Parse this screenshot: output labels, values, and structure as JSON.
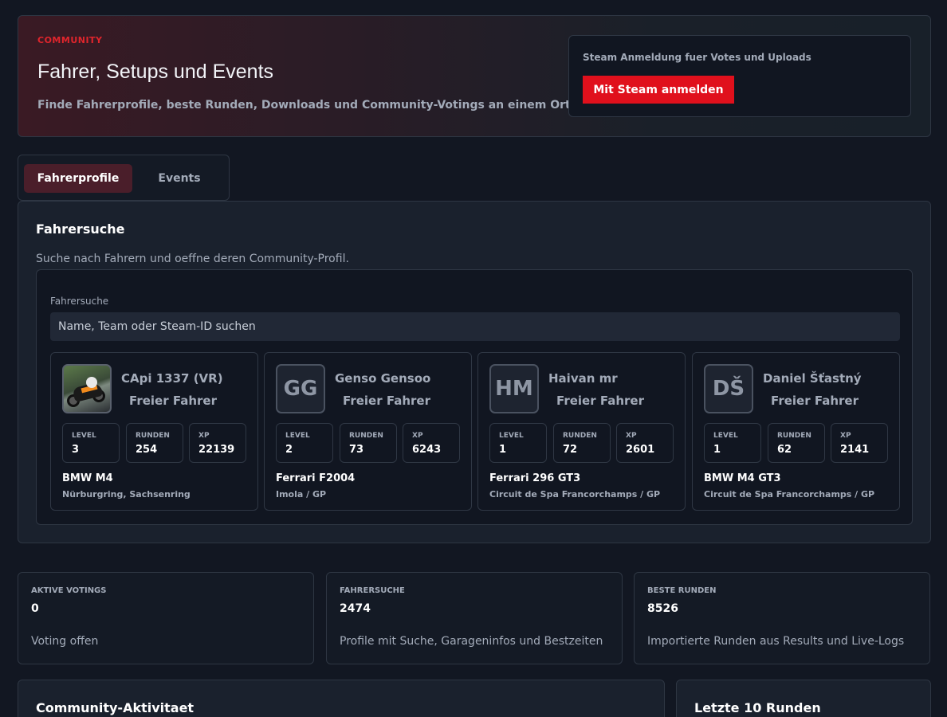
{
  "hero": {
    "eyebrow": "COMMUNITY",
    "title": "Fahrer, Setups und Events",
    "subtitle": "Finde Fahrerprofile, beste Runden, Downloads und Community-Votings an einem Ort.",
    "login_hint": "Steam Anmeldung fuer Votes und Uploads",
    "login_button": "Mit Steam anmelden",
    "accent_color": "#e0101c"
  },
  "tabs": [
    {
      "label": "Fahrerprofile",
      "active": true
    },
    {
      "label": "Events",
      "active": false
    }
  ],
  "driver_search": {
    "title": "Fahrersuche",
    "description": "Suche nach Fahrern und oeffne deren Community-Profil.",
    "field_label": "Fahrersuche",
    "placeholder": "Name, Team oder Steam-ID suchen",
    "stat_labels": {
      "level": "LEVEL",
      "runden": "RUNDEN",
      "xp": "XP"
    },
    "drivers": [
      {
        "name": "CApi 1337 (VR)",
        "role": "Freier Fahrer",
        "avatar": "motorcycle-photo",
        "initials": "",
        "level": "3",
        "runden": "254",
        "xp": "22139",
        "car": "BMW M4",
        "track": "Nürburgring, Sachsenring"
      },
      {
        "name": "Genso Gensoo",
        "role": "Freier Fahrer",
        "avatar": "initials",
        "initials": "GG",
        "level": "2",
        "runden": "73",
        "xp": "6243",
        "car": "Ferrari F2004",
        "track": "Imola / GP"
      },
      {
        "name": "Haivan mr",
        "role": "Freier Fahrer",
        "avatar": "initials",
        "initials": "HM",
        "level": "1",
        "runden": "72",
        "xp": "2601",
        "car": "Ferrari 296 GT3",
        "track": "Circuit de Spa Francorchamps / GP"
      },
      {
        "name": "Daniel Šťastný",
        "role": "Freier Fahrer",
        "avatar": "initials",
        "initials": "DŠ",
        "level": "1",
        "runden": "62",
        "xp": "2141",
        "car": "BMW M4 GT3",
        "track": "Circuit de Spa Francorchamps / GP"
      }
    ]
  },
  "metrics": [
    {
      "label": "AKTIVE VOTINGS",
      "value": "0",
      "desc": "Voting offen"
    },
    {
      "label": "FAHRERSUCHE",
      "value": "2474",
      "desc": "Profile mit Suche, Garageninfos und Bestzeiten"
    },
    {
      "label": "BESTE RUNDEN",
      "value": "8526",
      "desc": "Importierte Runden aus Results und Live-Logs"
    }
  ],
  "bottom": {
    "activity_title": "Community-Aktivitaet",
    "laps_title": "Letzte 10 Runden"
  }
}
